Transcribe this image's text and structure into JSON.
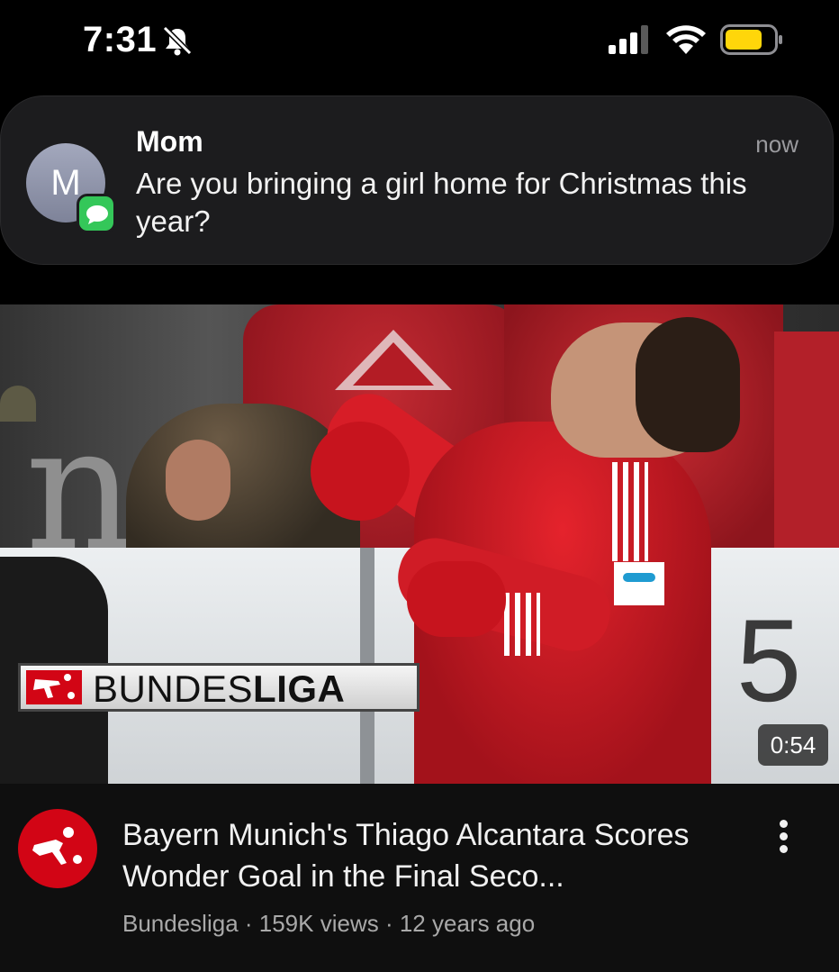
{
  "status_bar": {
    "time": "7:31",
    "silent_icon": "bell-slash-icon",
    "signal_icon": "cellular-signal-icon",
    "wifi_icon": "wifi-icon",
    "battery_icon": "battery-icon",
    "battery_color": "#ffd60a"
  },
  "notification": {
    "avatar_letter": "M",
    "app_icon": "messages-icon",
    "sender": "Mom",
    "time": "now",
    "message": "Are you bringing a girl home for Christmas this year?"
  },
  "video": {
    "thumbnail_logo_text_light": "BUNDES",
    "thumbnail_logo_text_bold": "LIGA",
    "duration": "0:54",
    "title": "Bayern Munich's Thiago Alcantara Scores Wonder Goal in the Final Seco...",
    "channel": "Bundesliga",
    "views": "159K views",
    "age": "12 years ago",
    "meta_separator": " · ",
    "channel_icon": "bundesliga-logo-icon",
    "more_icon": "more-vertical-icon",
    "brand_color": "#d20515"
  }
}
